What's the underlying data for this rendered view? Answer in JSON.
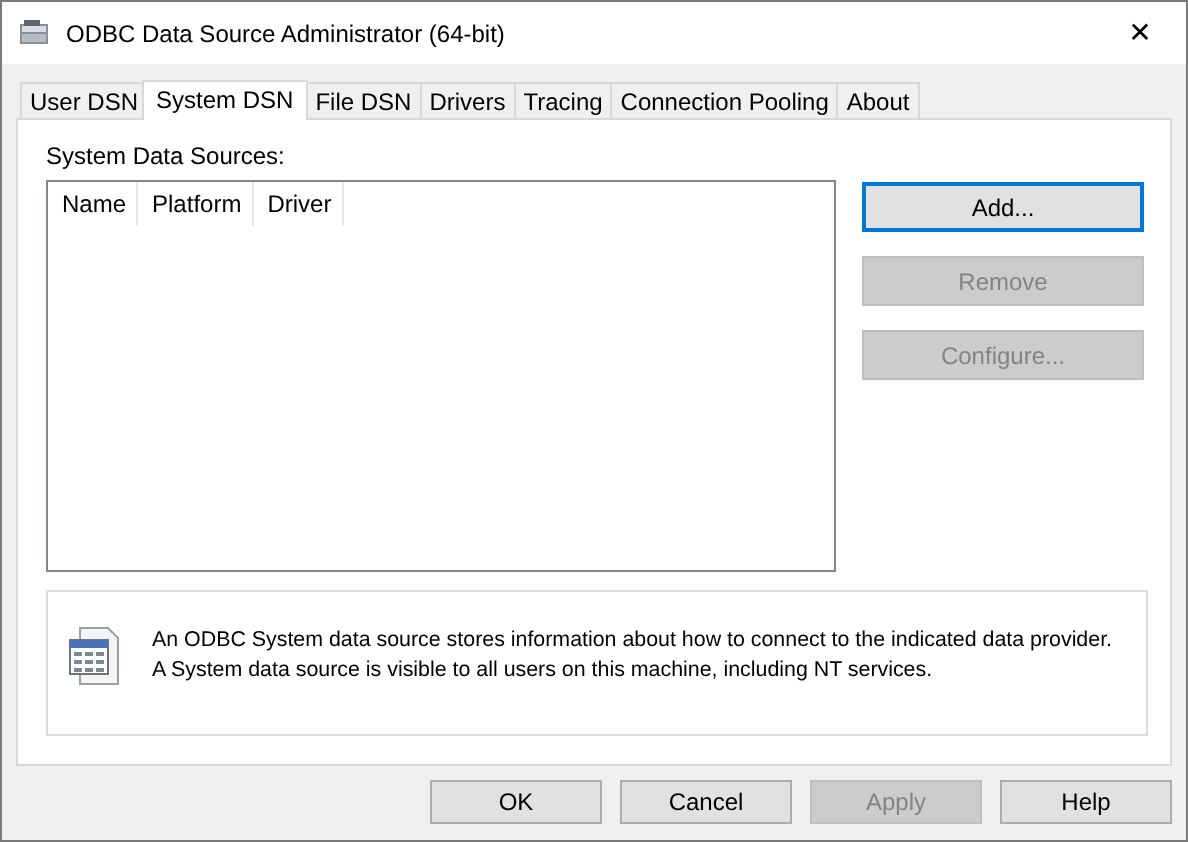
{
  "window": {
    "title": "ODBC Data Source Administrator (64-bit)",
    "close": "✕"
  },
  "tabs": [
    {
      "label": "User DSN",
      "selected": false
    },
    {
      "label": "System DSN",
      "selected": true
    },
    {
      "label": "File DSN",
      "selected": false
    },
    {
      "label": "Drivers",
      "selected": false
    },
    {
      "label": "Tracing",
      "selected": false
    },
    {
      "label": "Connection Pooling",
      "selected": false
    },
    {
      "label": "About",
      "selected": false
    }
  ],
  "list_label": "System Data Sources:",
  "list": {
    "columns": [
      "Name",
      "Platform",
      "Driver"
    ]
  },
  "side_buttons": [
    {
      "label": "Add...",
      "disabled": false,
      "focused": true
    },
    {
      "label": "Remove",
      "disabled": true,
      "focused": false
    },
    {
      "label": "Configure...",
      "disabled": true,
      "focused": false
    }
  ],
  "info": {
    "lines": [
      "An ODBC System data source stores information about how to connect to the indicated data provider.",
      "A System data source is visible to all users on this machine, including NT services."
    ]
  },
  "dialog_buttons": [
    {
      "label": "OK",
      "disabled": false
    },
    {
      "label": "Cancel",
      "disabled": false
    },
    {
      "label": "Apply",
      "disabled": true
    },
    {
      "label": "Help",
      "disabled": false
    }
  ]
}
